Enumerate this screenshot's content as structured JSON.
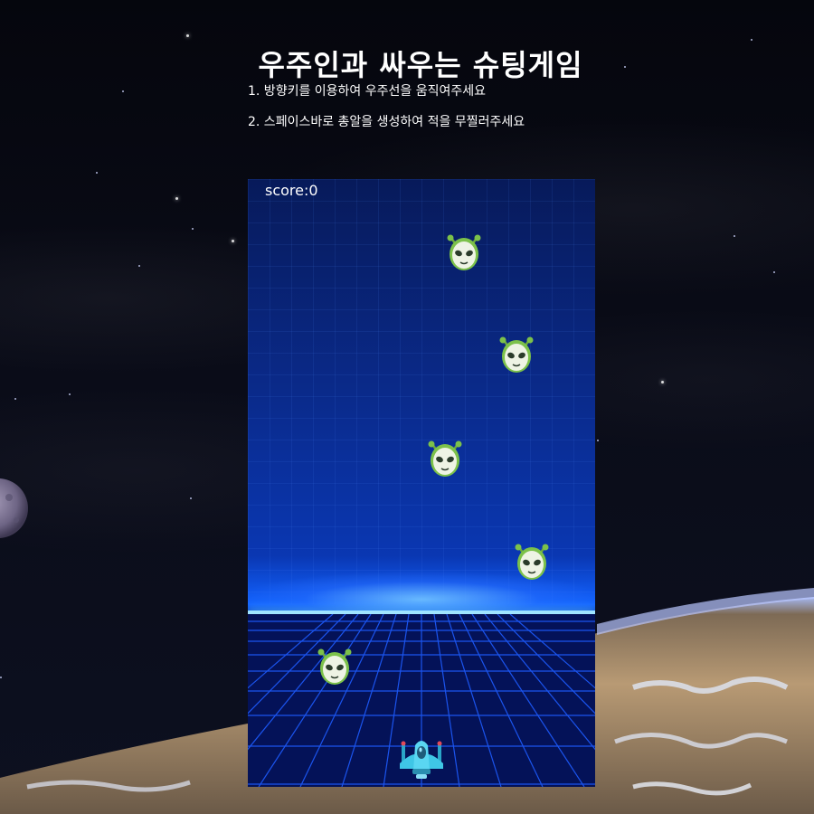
{
  "title": "우주인과 싸우는 슈팅게임",
  "instructions": [
    "1. 방향키를 이용하여 우주선을 움직여주세요",
    "2. 스페이스바로 총알을 생성하여 적을 무찔러주세요"
  ],
  "game": {
    "score_label": "score:0",
    "score": 0,
    "enemy_icon": "alien-face-icon",
    "player_icon": "spaceship-icon",
    "colors": {
      "background": "#05070f",
      "canvas_top": "#071a5a",
      "horizon_glow": "#9fe4ff",
      "alien_green": "#7cc14a",
      "ship_cyan": "#3fc6e6"
    }
  }
}
